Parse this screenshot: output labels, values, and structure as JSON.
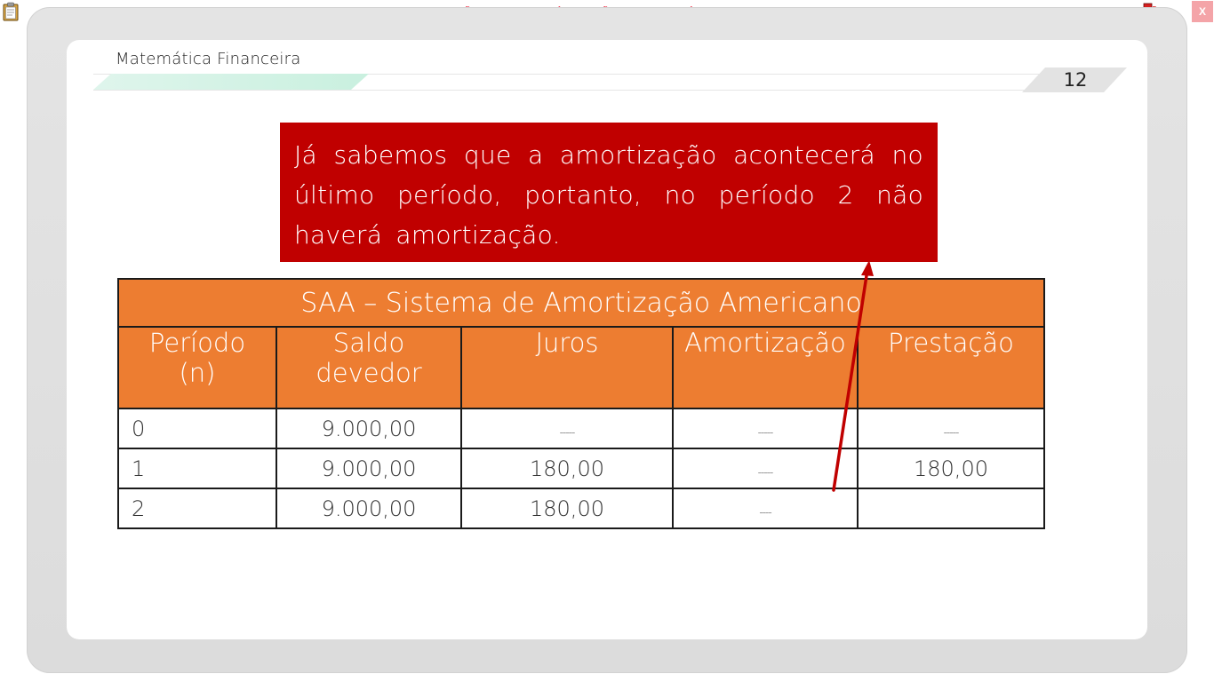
{
  "app": {
    "banner": "VERSÃO PARA FUNCIONÁRIOS - NÃO COMERCIALIZÁVEL",
    "close_label": "X"
  },
  "slide": {
    "course_title": "Matemática Financeira",
    "page_number": "12",
    "callout_text": "Já sabemos que a amortização acontecerá no último período, portanto, no período 2 não haverá amortização.",
    "accent_color": "#c00000"
  },
  "table": {
    "title": "SAA – Sistema de Amortização Americano",
    "header_color": "#ed7d31",
    "headers": [
      {
        "line1": "Período",
        "line2": "(n)"
      },
      {
        "line1": "Saldo",
        "line2": "devedor"
      },
      {
        "line1": "Juros",
        "line2": ""
      },
      {
        "line1": "Amortização",
        "line2": ""
      },
      {
        "line1": "Prestação",
        "line2": ""
      }
    ],
    "rows": [
      [
        "0",
        "9.000,00",
        "-----",
        "-----",
        "-----"
      ],
      [
        "1",
        "9.000,00",
        "180,00",
        "-----",
        "180,00"
      ],
      [
        "2",
        "9.000,00",
        "180,00",
        "----",
        ""
      ]
    ]
  }
}
